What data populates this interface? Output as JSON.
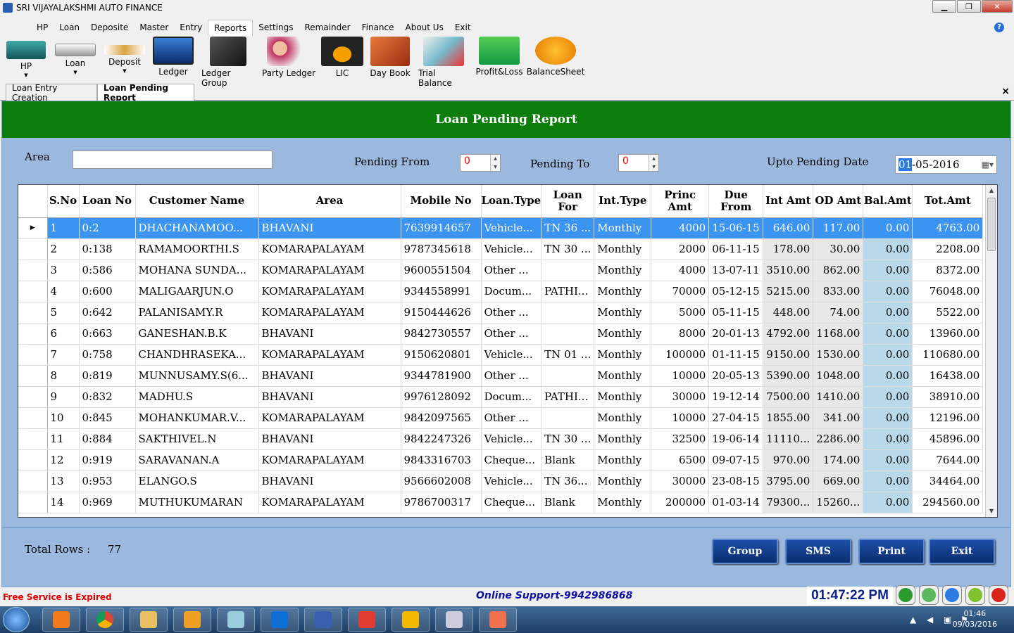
{
  "window": {
    "title": "SRI VIJAYALAKSHMI AUTO FINANCE"
  },
  "menu": [
    "HP",
    "Loan",
    "Deposite",
    "Master",
    "Entry",
    "Reports",
    "Settings",
    "Remainder",
    "Finance",
    "About Us",
    "Exit"
  ],
  "menu_active": "Reports",
  "toolbar": {
    "hp": "HP",
    "loan": "Loan",
    "deposit": "Deposit",
    "ledger": "Ledger",
    "ledger_group": "Ledger Group",
    "party_ledger": "Party Ledger",
    "lic": "LIC",
    "day_book": "Day Book",
    "trial_balance": "Trial Balance",
    "profit_loss": "Profit&Loss",
    "balance_sheet": "BalanceSheet"
  },
  "tabs": {
    "tab1": "Loan Entry Creation",
    "tab2": "Loan Pending Report",
    "close": "×"
  },
  "report": {
    "header": "Loan Pending Report",
    "area_label": "Area",
    "area_value": "",
    "pending_from_label": "Pending From",
    "pending_from": "0",
    "pending_to_label": "Pending To",
    "pending_to": "0",
    "upto_label": "Upto Pending Date",
    "date_sel": "01",
    "date_rest": "-05-2016"
  },
  "grid": {
    "headers": [
      "S.No",
      "Loan No",
      "Customer Name",
      "Area",
      "Mobile No",
      "Loan.Type",
      "Loan For",
      "Int.Type",
      "Princ Amt",
      "Due From",
      "Int Amt",
      "OD Amt",
      "Bal.Amt",
      "Tot.Amt"
    ],
    "rows": [
      [
        "1",
        "0:2",
        "DHACHANAMOO...",
        "BHAVANI",
        "7639914657",
        "Vehicle...",
        "TN 36 ...",
        "Monthly",
        "4000",
        "15-06-15",
        "646.00",
        "117.00",
        "0.00",
        "4763.00"
      ],
      [
        "2",
        "0:138",
        "RAMAMOORTHI.S",
        "KOMARAPALAYAM",
        "9787345618",
        "Vehicle...",
        "TN 30 ...",
        "Monthly",
        "2000",
        "06-11-15",
        "178.00",
        "30.00",
        "0.00",
        "2208.00"
      ],
      [
        "3",
        "0:586",
        "MOHANA SUNDA...",
        "KOMARAPALAYAM",
        "9600551504",
        "Other ...",
        "",
        "Monthly",
        "4000",
        "13-07-11",
        "3510.00",
        "862.00",
        "0.00",
        "8372.00"
      ],
      [
        "4",
        "0:600",
        "MALIGAARJUN.O",
        "KOMARAPALAYAM",
        "9344558991",
        "Docum...",
        "PATHI...",
        "Monthly",
        "70000",
        "05-12-15",
        "5215.00",
        "833.00",
        "0.00",
        "76048.00"
      ],
      [
        "5",
        "0:642",
        "PALANISAMY.R",
        "KOMARAPALAYAM",
        "9150444626",
        "Other ...",
        "",
        "Monthly",
        "5000",
        "05-11-15",
        "448.00",
        "74.00",
        "0.00",
        "5522.00"
      ],
      [
        "6",
        "0:663",
        "GANESHAN.B.K",
        "BHAVANI",
        "9842730557",
        "Other ...",
        "",
        "Monthly",
        "8000",
        "20-01-13",
        "4792.00",
        "1168.00",
        "0.00",
        "13960.00"
      ],
      [
        "7",
        "0:758",
        "CHANDHRASEKA...",
        "KOMARAPALAYAM",
        "9150620801",
        "Vehicle...",
        "TN 01 ...",
        "Monthly",
        "100000",
        "01-11-15",
        "9150.00",
        "1530.00",
        "0.00",
        "110680.00"
      ],
      [
        "8",
        "0:819",
        "MUNNUSAMY.S(6...",
        "BHAVANI",
        "9344781900",
        "Other ...",
        "",
        "Monthly",
        "10000",
        "20-05-13",
        "5390.00",
        "1048.00",
        "0.00",
        "16438.00"
      ],
      [
        "9",
        "0:832",
        "MADHU.S",
        "BHAVANI",
        "9976128092",
        "Docum...",
        "PATHI...",
        "Monthly",
        "30000",
        "19-12-14",
        "7500.00",
        "1410.00",
        "0.00",
        "38910.00"
      ],
      [
        "10",
        "0:845",
        "MOHANKUMAR.V...",
        "KOMARAPALAYAM",
        "9842097565",
        "Other ...",
        "",
        "Monthly",
        "10000",
        "27-04-15",
        "1855.00",
        "341.00",
        "0.00",
        "12196.00"
      ],
      [
        "11",
        "0:884",
        "SAKTHIVEL.N",
        "BHAVANI",
        "9842247326",
        "Vehicle...",
        "TN 30 ...",
        "Monthly",
        "32500",
        "19-06-14",
        "11110...",
        "2286.00",
        "0.00",
        "45896.00"
      ],
      [
        "12",
        "0:919",
        "SARAVANAN.A",
        "KOMARAPALAYAM",
        "9843316703",
        "Cheque...",
        "Blank",
        "Monthly",
        "6500",
        "09-07-15",
        "970.00",
        "174.00",
        "0.00",
        "7644.00"
      ],
      [
        "13",
        "0:953",
        "ELANGO.S",
        "BHAVANI",
        "9566602008",
        "Vehicle...",
        "TN 36...",
        "Monthly",
        "30000",
        "23-08-15",
        "3795.00",
        "669.00",
        "0.00",
        "34464.00"
      ],
      [
        "14",
        "0:969",
        "MUTHUKUMARAN",
        "KOMARAPALAYAM",
        "9786700317",
        "Cheque...",
        "Blank",
        "Monthly",
        "200000",
        "01-03-14",
        "79300...",
        "15260...",
        "0.00",
        "294560.00"
      ]
    ]
  },
  "footer": {
    "total_rows_label": "Total Rows :",
    "total_rows": "77",
    "group": "Group",
    "sms": "SMS",
    "print": "Print",
    "exit": "Exit"
  },
  "status": {
    "expired": "Free Service is Expired",
    "support": "Online Support-9942986868",
    "clock": "01:47:22 PM"
  },
  "taskbar": {
    "time": "01:46",
    "date": "09/03/2016"
  },
  "colors": {
    "header_green": "#0b7d0b",
    "panel_blue": "#9bb9df",
    "selected_row": "#3b95f0",
    "button_navy": "#0a2d6f"
  }
}
